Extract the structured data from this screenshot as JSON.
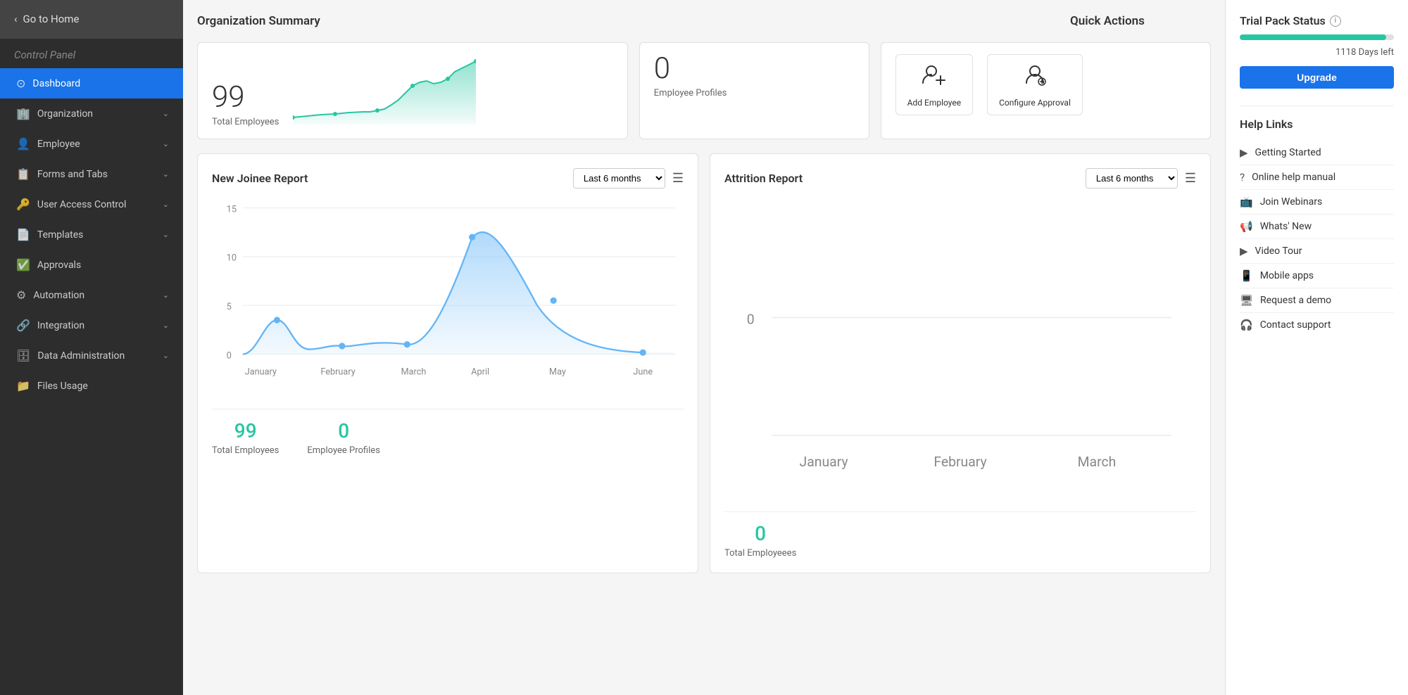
{
  "sidebar": {
    "go_home": "Go to Home",
    "control_panel": "Control Panel",
    "items": [
      {
        "id": "dashboard",
        "icon": "⊙",
        "label": "Dashboard",
        "active": true,
        "has_chevron": false
      },
      {
        "id": "organization",
        "icon": "🏢",
        "label": "Organization",
        "active": false,
        "has_chevron": true
      },
      {
        "id": "employee",
        "icon": "👤",
        "label": "Employee",
        "active": false,
        "has_chevron": true
      },
      {
        "id": "forms-tabs",
        "icon": "📋",
        "label": "Forms and Tabs",
        "active": false,
        "has_chevron": true
      },
      {
        "id": "user-access",
        "icon": "🔑",
        "label": "User Access Control",
        "active": false,
        "has_chevron": true
      },
      {
        "id": "templates",
        "icon": "📄",
        "label": "Templates",
        "active": false,
        "has_chevron": true
      },
      {
        "id": "approvals",
        "icon": "✅",
        "label": "Approvals",
        "active": false,
        "has_chevron": false
      },
      {
        "id": "automation",
        "icon": "⚙",
        "label": "Automation",
        "active": false,
        "has_chevron": true
      },
      {
        "id": "integration",
        "icon": "🔗",
        "label": "Integration",
        "active": false,
        "has_chevron": true
      },
      {
        "id": "data-admin",
        "icon": "🗄",
        "label": "Data Administration",
        "active": false,
        "has_chevron": true
      },
      {
        "id": "files-usage",
        "icon": "📁",
        "label": "Files Usage",
        "active": false,
        "has_chevron": false
      }
    ]
  },
  "org_summary": {
    "section_title": "Organization Summary",
    "total_employees_num": "99",
    "total_employees_label": "Total Employees",
    "employee_profiles_num": "0",
    "employee_profiles_label": "Employee Profiles"
  },
  "quick_actions": {
    "section_title": "Quick Actions",
    "buttons": [
      {
        "id": "add-employee",
        "icon": "👤+",
        "label": "Add Employee"
      },
      {
        "id": "configure-approval",
        "icon": "⚙👤",
        "label": "Configure Approval"
      }
    ]
  },
  "trial_pack": {
    "title": "Trial Pack Status",
    "progress_percent": 95,
    "days_left": "1118 Days left",
    "upgrade_label": "Upgrade"
  },
  "help_links": {
    "title": "Help Links",
    "items": [
      {
        "id": "getting-started",
        "icon": "▶",
        "label": "Getting Started"
      },
      {
        "id": "online-help",
        "icon": "?",
        "label": "Online help manual"
      },
      {
        "id": "join-webinars",
        "icon": "📺",
        "label": "Join Webinars"
      },
      {
        "id": "whats-new",
        "icon": "📢",
        "label": "Whats' New"
      },
      {
        "id": "video-tour",
        "icon": "▶",
        "label": "Video Tour"
      },
      {
        "id": "mobile-apps",
        "icon": "📱",
        "label": "Mobile apps"
      },
      {
        "id": "request-demo",
        "icon": "🖥",
        "label": "Request a demo"
      },
      {
        "id": "contact-support",
        "icon": "🎧",
        "label": "Contact support"
      }
    ]
  },
  "new_joinee_report": {
    "title": "New Joinee Report",
    "period": "Last 6 months",
    "y_labels": [
      "15",
      "10",
      "5",
      "0"
    ],
    "x_labels": [
      "January",
      "February",
      "March",
      "April",
      "May",
      "June"
    ],
    "stats": [
      {
        "num": "99",
        "label": "Total Employees"
      },
      {
        "num": "0",
        "label": "Employee Profiles"
      }
    ]
  },
  "attrition_report": {
    "title": "Attrition Report",
    "period": "Last 6 months",
    "y_labels": [
      "0"
    ],
    "x_labels": [
      "January",
      "February",
      "March"
    ],
    "stats": [
      {
        "num": "0",
        "label": "Total Employeees"
      }
    ]
  }
}
